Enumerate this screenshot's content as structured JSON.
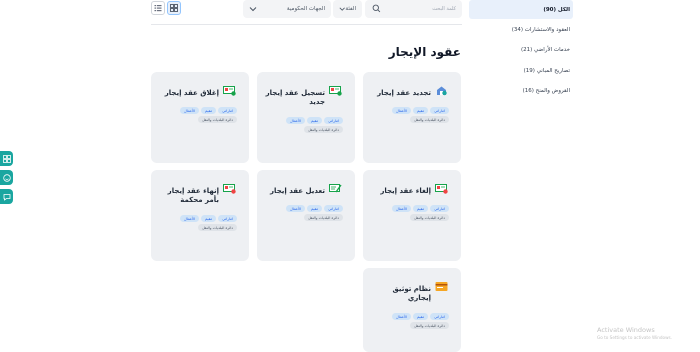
{
  "sidebar": {
    "items": [
      {
        "label": "الكل (90)",
        "active": true
      },
      {
        "label": "العقود والاستشارات (34)",
        "active": false
      },
      {
        "label": "خدمات الأراضي (21)",
        "active": false
      },
      {
        "label": "تصاريح المباني (19)",
        "active": false
      },
      {
        "label": "القروض والمنح (16)",
        "active": false
      }
    ]
  },
  "filters": {
    "search_placeholder": "كلمة البحث",
    "category_label": "الفئة",
    "gov_label": "الجهات الحكومية"
  },
  "page": {
    "title": "عقود الإيجار"
  },
  "cards": [
    {
      "title": "تجديد عقد إيجار",
      "icon": "renew-contract-icon",
      "tags": [
        "اماراتي",
        "مقيم",
        "الأعمال",
        "دائرة البلديات والنقل"
      ]
    },
    {
      "title": "تسجيل عقد إيجار جديد",
      "icon": "register-contract-icon",
      "tags": [
        "اماراتي",
        "مقيم",
        "الأعمال",
        "دائرة البلديات والنقل"
      ]
    },
    {
      "title": "إغلاق عقد إيجار",
      "icon": "close-contract-icon",
      "tags": [
        "اماراتي",
        "مقيم",
        "الأعمال",
        "دائرة البلديات والنقل"
      ]
    },
    {
      "title": "إلغاء عقد إيجار",
      "icon": "cancel-contract-icon",
      "tags": [
        "اماراتي",
        "مقيم",
        "الأعمال",
        "دائرة البلديات والنقل"
      ]
    },
    {
      "title": "تعديل عقد إيجار",
      "icon": "edit-contract-icon",
      "tags": [
        "اماراتي",
        "مقيم",
        "الأعمال",
        "دائرة البلديات والنقل"
      ]
    },
    {
      "title": "إنهاء عقد إيجار بأمر محكمة",
      "icon": "court-terminate-icon",
      "tags": [
        "اماراتي",
        "مقيم",
        "الأعمال",
        "دائرة البلديات والنقل"
      ]
    },
    {
      "title": "نظام توثيق إيجاري",
      "icon": "ejari-system-icon",
      "tags": [
        "اماراتي",
        "مقيم",
        "الأعمال",
        "دائرة البلديات والنقل"
      ]
    }
  ],
  "watermark": {
    "line1": "Activate Windows",
    "line2": "Go to Settings to activate Windows."
  }
}
